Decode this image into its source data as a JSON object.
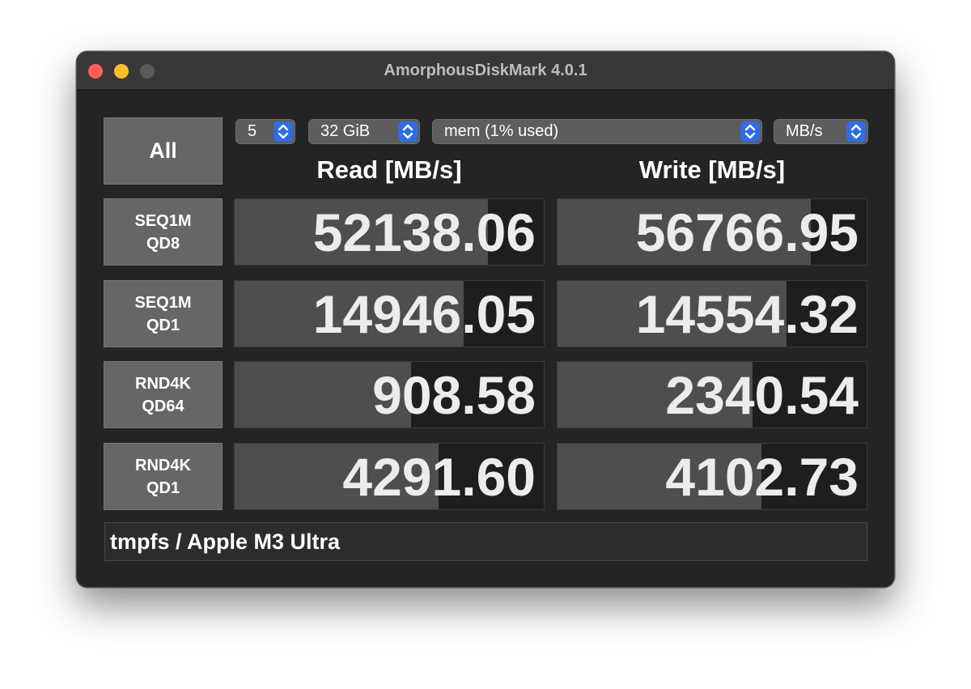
{
  "window": {
    "title": "AmorphousDiskMark 4.0.1"
  },
  "controls": {
    "all_label": "All",
    "count": "5",
    "size": "32 GiB",
    "target": "mem (1% used)",
    "unit": "MB/s"
  },
  "headers": {
    "read": "Read [MB/s]",
    "write": "Write [MB/s]"
  },
  "tests": [
    {
      "line1": "SEQ1M",
      "line2": "QD8",
      "read": "52138.06",
      "write": "56766.95",
      "read_fill": 0.82,
      "write_fill": 0.82
    },
    {
      "line1": "SEQ1M",
      "line2": "QD1",
      "read": "14946.05",
      "write": "14554.32",
      "read_fill": 0.74,
      "write_fill": 0.74
    },
    {
      "line1": "RND4K",
      "line2": "QD64",
      "read": "908.58",
      "write": "2340.54",
      "read_fill": 0.57,
      "write_fill": 0.63
    },
    {
      "line1": "RND4K",
      "line2": "QD1",
      "read": "4291.60",
      "write": "4102.73",
      "read_fill": 0.66,
      "write_fill": 0.66
    }
  ],
  "comment": "tmpfs / Apple M3 Ultra",
  "colors": {
    "close": "#ff5f57",
    "minimize": "#febc2e",
    "accent": "#2f6de1"
  }
}
